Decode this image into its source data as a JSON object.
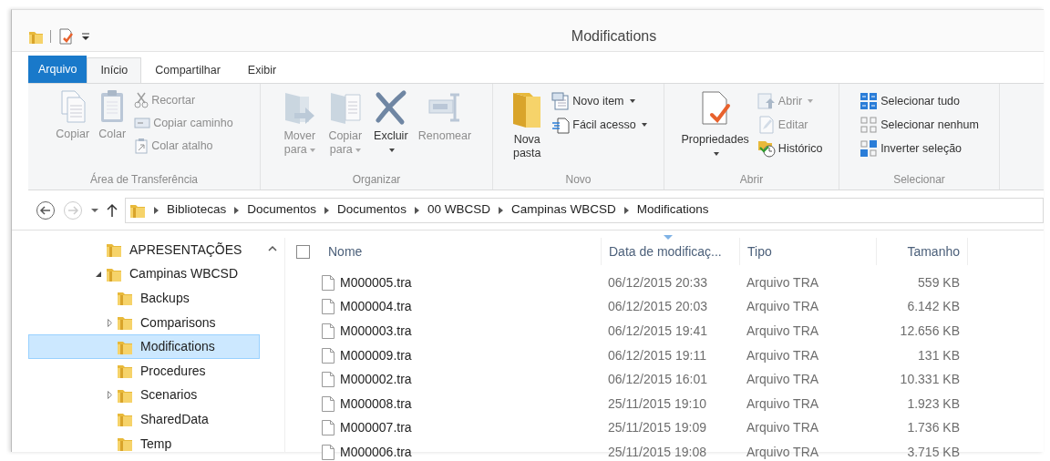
{
  "window": {
    "title": "Modifications"
  },
  "tabs": [
    {
      "label": "Arquivo",
      "kind": "file",
      "selected": false
    },
    {
      "label": "Início",
      "kind": "tab",
      "selected": true
    },
    {
      "label": "Compartilhar",
      "kind": "tab",
      "selected": false
    },
    {
      "label": "Exibir",
      "kind": "tab",
      "selected": false
    }
  ],
  "ribbon": [
    {
      "label": "Área de Transferência",
      "items": [
        {
          "label": "Copiar",
          "kind": "large",
          "disabled": true,
          "dropdown": false
        },
        {
          "label": "Colar",
          "kind": "large",
          "disabled": true,
          "dropdown": false
        },
        {
          "label": "Recortar",
          "kind": "small",
          "disabled": true,
          "dropdown": false
        },
        {
          "label": "Copiar caminho",
          "kind": "small",
          "disabled": true,
          "dropdown": false
        },
        {
          "label": "Colar atalho",
          "kind": "small",
          "disabled": true,
          "dropdown": false
        }
      ]
    },
    {
      "label": "Organizar",
      "items": [
        {
          "label": "Mover para",
          "kind": "large",
          "disabled": true,
          "dropdown": true
        },
        {
          "label": "Copiar para",
          "kind": "large",
          "disabled": true,
          "dropdown": true
        },
        {
          "label": "Excluir",
          "kind": "large",
          "disabled": false,
          "dropdown": true
        },
        {
          "label": "Renomear",
          "kind": "large",
          "disabled": true,
          "dropdown": false
        }
      ]
    },
    {
      "label": "Novo",
      "items": [
        {
          "label": "Nova pasta",
          "kind": "large",
          "disabled": false,
          "dropdown": false
        },
        {
          "label": "Novo item",
          "kind": "small",
          "disabled": false,
          "dropdown": true
        },
        {
          "label": "Fácil acesso",
          "kind": "small",
          "disabled": false,
          "dropdown": true
        }
      ]
    },
    {
      "label": "Abrir",
      "items": [
        {
          "label": "Propriedades",
          "kind": "large",
          "disabled": false,
          "dropdown": true
        },
        {
          "label": "Abrir",
          "kind": "small",
          "disabled": true,
          "dropdown": true
        },
        {
          "label": "Editar",
          "kind": "small",
          "disabled": true,
          "dropdown": false
        },
        {
          "label": "Histórico",
          "kind": "small",
          "disabled": false,
          "dropdown": false
        }
      ]
    },
    {
      "label": "Selecionar",
      "items": [
        {
          "label": "Selecionar tudo",
          "kind": "small",
          "disabled": false,
          "dropdown": false
        },
        {
          "label": "Selecionar nenhum",
          "kind": "small",
          "disabled": false,
          "dropdown": false
        },
        {
          "label": "Inverter seleção",
          "kind": "small",
          "disabled": false,
          "dropdown": false
        }
      ]
    }
  ],
  "nav": {
    "back_disabled": false,
    "forward_disabled": true
  },
  "breadcrumb": [
    "Bibliotecas",
    "Documentos",
    "Documentos",
    "00 WBCSD",
    "Campinas WBCSD",
    "Modifications"
  ],
  "tree": [
    {
      "label": "APRESENTAÇÕES",
      "has_children": false,
      "selected": false
    },
    {
      "label": "Campinas WBCSD",
      "has_children": true,
      "expanded": true,
      "selected": false,
      "children": [
        {
          "label": "Backups",
          "has_children": false,
          "selected": false
        },
        {
          "label": "Comparisons",
          "has_children": true,
          "expanded": false,
          "selected": false
        },
        {
          "label": "Modifications",
          "has_children": false,
          "selected": true
        },
        {
          "label": "Procedures",
          "has_children": false,
          "selected": false
        },
        {
          "label": "Scenarios",
          "has_children": true,
          "expanded": false,
          "selected": false
        },
        {
          "label": "SharedData",
          "has_children": false,
          "selected": false
        },
        {
          "label": "Temp",
          "has_children": false,
          "selected": false
        }
      ]
    }
  ],
  "table": {
    "select_all_checked": false,
    "columns": [
      {
        "label": "Nome",
        "sorted": false
      },
      {
        "label": "Data de modificaç...",
        "sorted": true
      },
      {
        "label": "Tipo",
        "sorted": false
      },
      {
        "label": "Tamanho",
        "sorted": false
      }
    ],
    "rows": [
      {
        "name": "M000005.tra",
        "date": "06/12/2015 20:33",
        "type": "Arquivo TRA",
        "size": "559 KB"
      },
      {
        "name": "M000004.tra",
        "date": "06/12/2015 20:03",
        "type": "Arquivo TRA",
        "size": "6.142 KB"
      },
      {
        "name": "M000003.tra",
        "date": "06/12/2015 19:41",
        "type": "Arquivo TRA",
        "size": "12.656 KB"
      },
      {
        "name": "M000009.tra",
        "date": "06/12/2015 19:11",
        "type": "Arquivo TRA",
        "size": "131 KB"
      },
      {
        "name": "M000002.tra",
        "date": "06/12/2015 16:01",
        "type": "Arquivo TRA",
        "size": "10.331 KB"
      },
      {
        "name": "M000008.tra",
        "date": "25/11/2015 19:10",
        "type": "Arquivo TRA",
        "size": "1.923 KB"
      },
      {
        "name": "M000007.tra",
        "date": "25/11/2015 19:09",
        "type": "Arquivo TRA",
        "size": "1.736 KB"
      },
      {
        "name": "M000006.tra",
        "date": "25/11/2015 19:08",
        "type": "Arquivo TRA",
        "size": "3.715 KB"
      }
    ]
  }
}
